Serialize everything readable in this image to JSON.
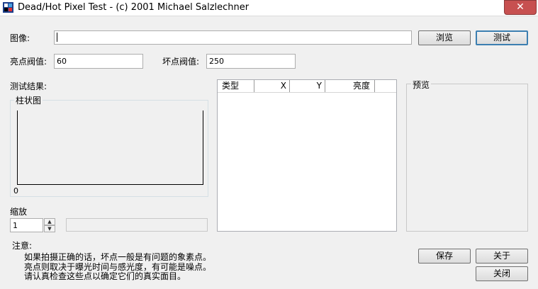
{
  "window": {
    "title": "Dead/Hot Pixel Test - (c) 2001 Michael Salzlechner",
    "close_glyph": "✕"
  },
  "image_row": {
    "label": "图像:",
    "value": "",
    "browse_label": "浏览",
    "test_label": "测试"
  },
  "thresholds": {
    "bright_label": "亮点阀值:",
    "bright_value": "60",
    "dead_label": "坏点阀值:",
    "dead_value": "250"
  },
  "results": {
    "label": "测试结果:",
    "histogram_caption": "柱状图",
    "histogram_zero": "0"
  },
  "list": {
    "columns": [
      "类型",
      "X",
      "Y",
      "亮度"
    ]
  },
  "preview": {
    "caption": "预览"
  },
  "zoom": {
    "label": "缩放",
    "value": "1",
    "up_glyph": "▲",
    "down_glyph": "▼"
  },
  "notes": {
    "title": "注意:",
    "lines": [
      "如果拍摄正确的话，坏点一般是有问题的象素点。",
      "亮点则取决于曝光时间与感光度，有可能是噪点。",
      "请认真检查这些点以确定它们的真实面目。"
    ]
  },
  "buttons": {
    "save_label": "保存",
    "about_label": "关于",
    "close_label": "关闭"
  }
}
